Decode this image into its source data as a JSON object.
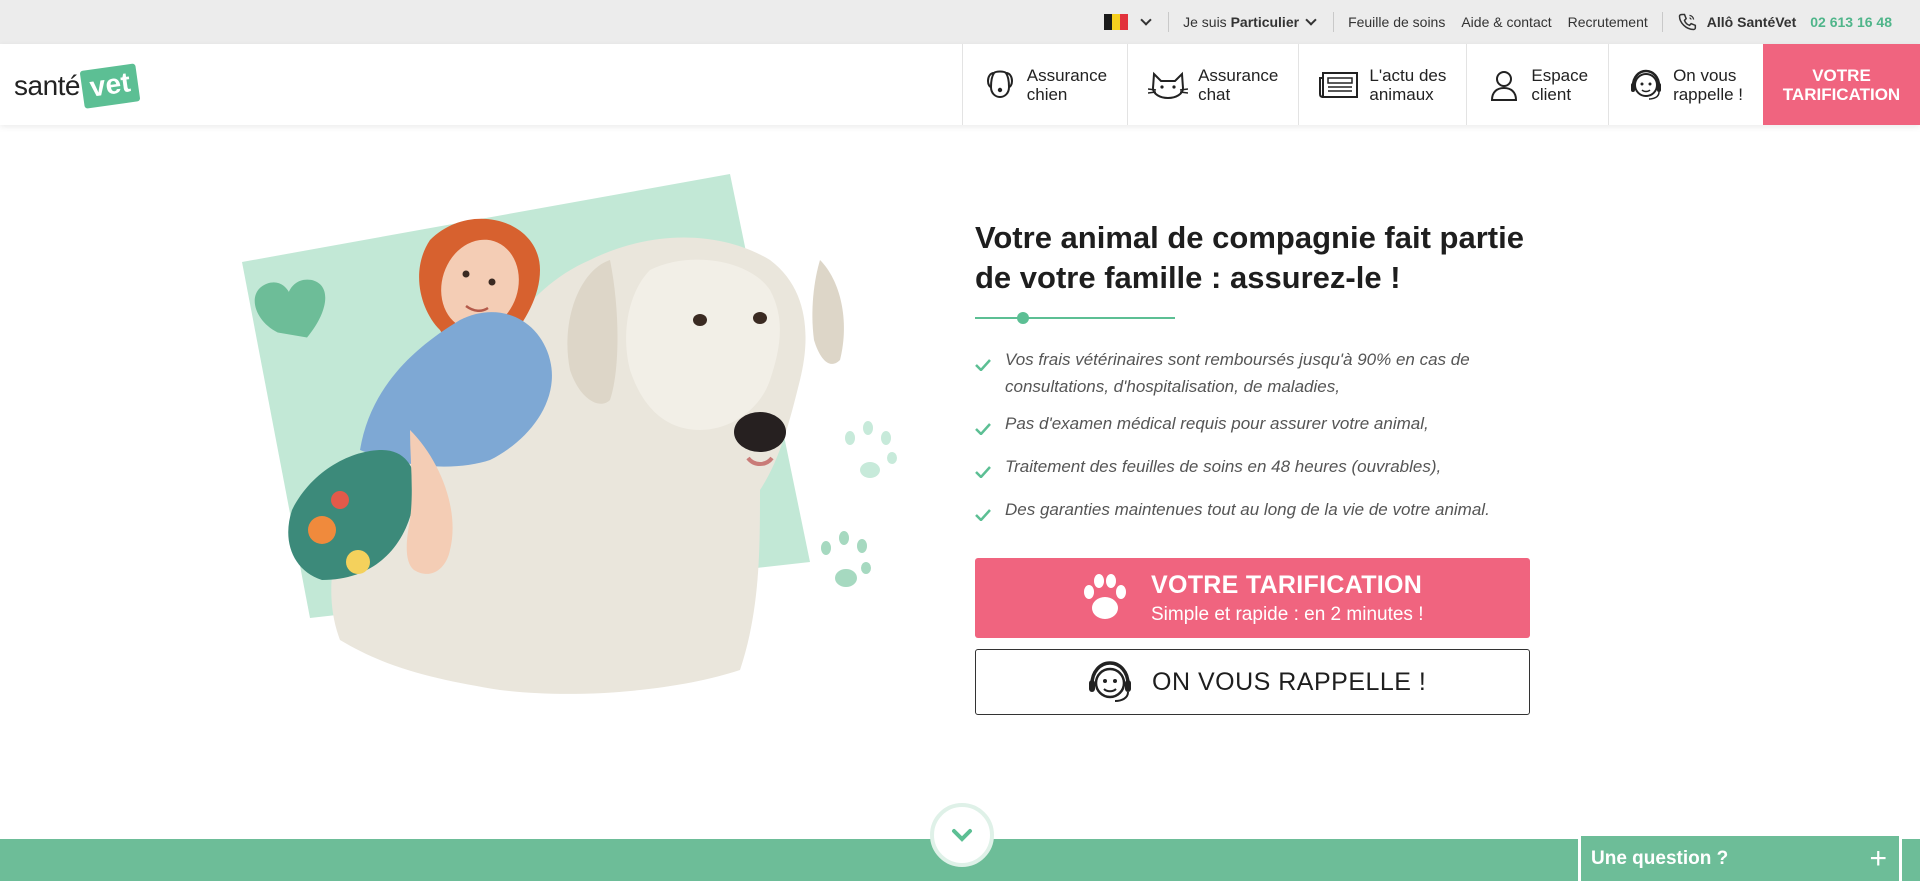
{
  "topbar": {
    "flag_colors": [
      "#1b1b1b",
      "#f6cf1f",
      "#e2323c"
    ],
    "profile_prefix": "Je suis",
    "profile_value": "Particulier",
    "links": [
      "Feuille de soins",
      "Aide & contact",
      "Recrutement"
    ],
    "phone_label": "Allô SantéVet",
    "phone_number": "02 613 16 48"
  },
  "header": {
    "logo_text": "santé",
    "logo_badge": "vet",
    "nav": [
      {
        "line1": "Assurance",
        "line2": "chien",
        "icon": "dog-icon"
      },
      {
        "line1": "Assurance",
        "line2": "chat",
        "icon": "cat-icon"
      },
      {
        "line1": "L'actu des",
        "line2": "animaux",
        "icon": "newspaper-icon"
      },
      {
        "line1": "Espace",
        "line2": "client",
        "icon": "user-icon"
      },
      {
        "line1": "On vous",
        "line2": "rappelle !",
        "icon": "headset-icon"
      }
    ],
    "cta_line1": "VOTRE",
    "cta_line2": "TARIFICATION"
  },
  "hero": {
    "title": "Votre animal de compagnie fait partie de votre famille : assurez-le !",
    "bullets": [
      "Vos frais vétérinaires sont remboursés jusqu'à 90% en cas de consultations, d'hospitalisation, de maladies,",
      "Pas d'examen médical requis pour assurer votre animal,",
      "Traitement des feuilles de soins en 48 heures (ouvrables),",
      "Des garanties maintenues tout au long de la vie de votre animal."
    ],
    "primary_button_title": "VOTRE TARIFICATION",
    "primary_button_subtitle": "Simple et rapide : en 2 minutes !",
    "secondary_button_label": "ON VOUS RAPPELLE !"
  },
  "chat_widget": {
    "label": "Une question ?",
    "plus": "+"
  },
  "colors": {
    "brand_green": "#5cbf94",
    "band_green": "#6dbd98",
    "accent_pink": "#f0647f",
    "mint_bg": "#c2e8d6"
  }
}
